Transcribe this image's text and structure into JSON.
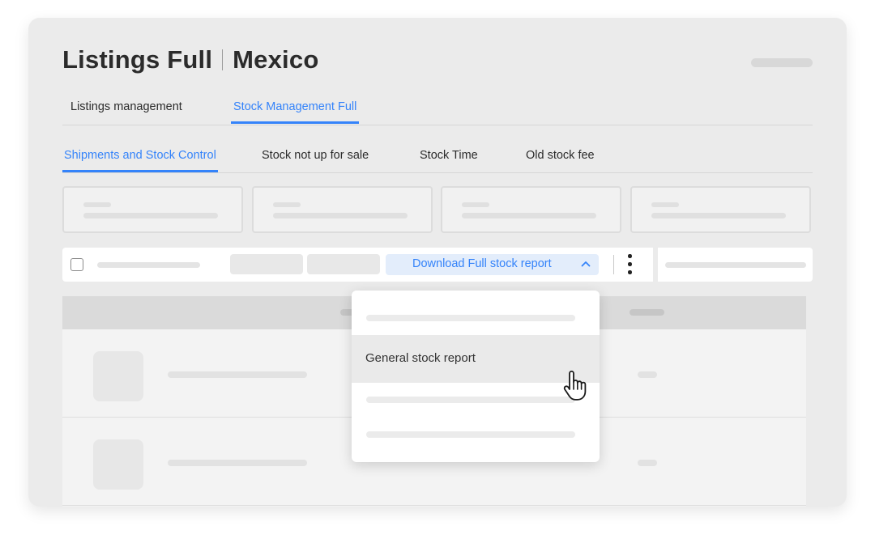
{
  "header": {
    "title": "Listings Full",
    "subtitle": "Mexico"
  },
  "tabs": [
    {
      "label": "Listings management",
      "active": false
    },
    {
      "label": "Stock Management Full",
      "active": true
    }
  ],
  "subtabs": [
    {
      "label": "Shipments and Stock Control",
      "active": true
    },
    {
      "label": "Stock not up for sale",
      "active": false
    },
    {
      "label": "Stock Time",
      "active": false
    },
    {
      "label": "Old stock fee",
      "active": false
    }
  ],
  "toolbar": {
    "download_label": "Download Full stock report",
    "download_icon": "chevron-up-icon",
    "more_icon": "kebab-menu-icon"
  },
  "dropdown": {
    "items": [
      {
        "label": "General stock report",
        "hovered": true
      }
    ]
  },
  "colors": {
    "accent": "#3483fa",
    "accent_bg": "#e3edfb",
    "card_bg": "#ebebeb",
    "text": "#2b2b2b"
  },
  "cursor_icon": "hand-pointer-icon"
}
